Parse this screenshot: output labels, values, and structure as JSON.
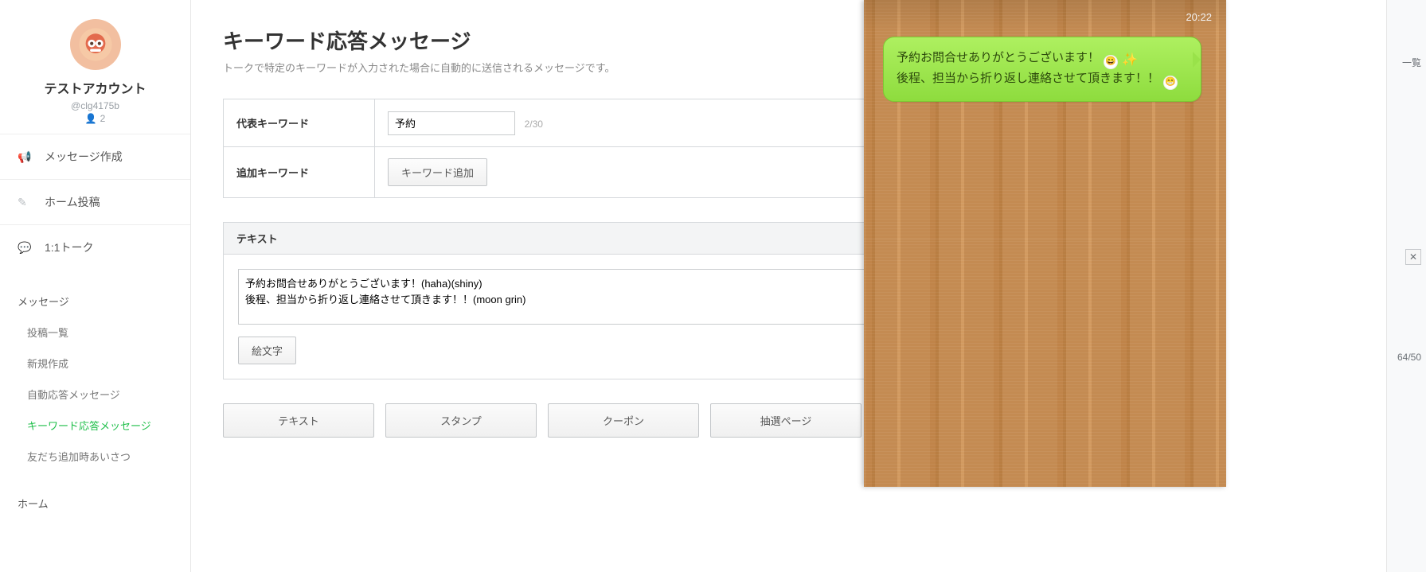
{
  "account": {
    "name": "テストアカウント",
    "id": "@clg4175b",
    "followers": "2"
  },
  "nav": {
    "compose": "メッセージ作成",
    "home_post": "ホーム投稿",
    "one_to_one": "1:1トーク"
  },
  "sections": {
    "messages_title": "メッセージ",
    "messages_items": {
      "post_list": "投稿一覧",
      "new": "新規作成",
      "auto_reply": "自動応答メッセージ",
      "keyword_reply": "キーワード応答メッセージ",
      "greeting": "友だち追加時あいさつ"
    },
    "home_title": "ホーム"
  },
  "page": {
    "title": "キーワード応答メッセージ",
    "description": "トークで特定のキーワードが入力された場合に自動的に送信されるメッセージです。"
  },
  "form": {
    "rep_keyword_label": "代表キーワード",
    "rep_keyword_value": "予約",
    "rep_keyword_count": "2/30",
    "add_keyword_label": "追加キーワード",
    "add_keyword_btn": "キーワード追加"
  },
  "text_panel": {
    "header": "テキスト",
    "body": "予約お問合せありがとうございます！(haha)(shiny)\n後程、担当から折り返し連絡させて頂きます！！(moon grin)",
    "emoji_btn": "絵文字"
  },
  "add_buttons": {
    "text": "テキスト",
    "stamp": "スタンプ",
    "coupon": "クーポン",
    "lottery": "抽選ページ"
  },
  "right_rail": {
    "link_list": "一覧",
    "char_count": "64/50"
  },
  "preview": {
    "time": "20:22",
    "bubble_line1": "予約お問合せありがとうございます！",
    "bubble_line2": "後程、担当から折り返し連絡させて頂きます！！"
  }
}
